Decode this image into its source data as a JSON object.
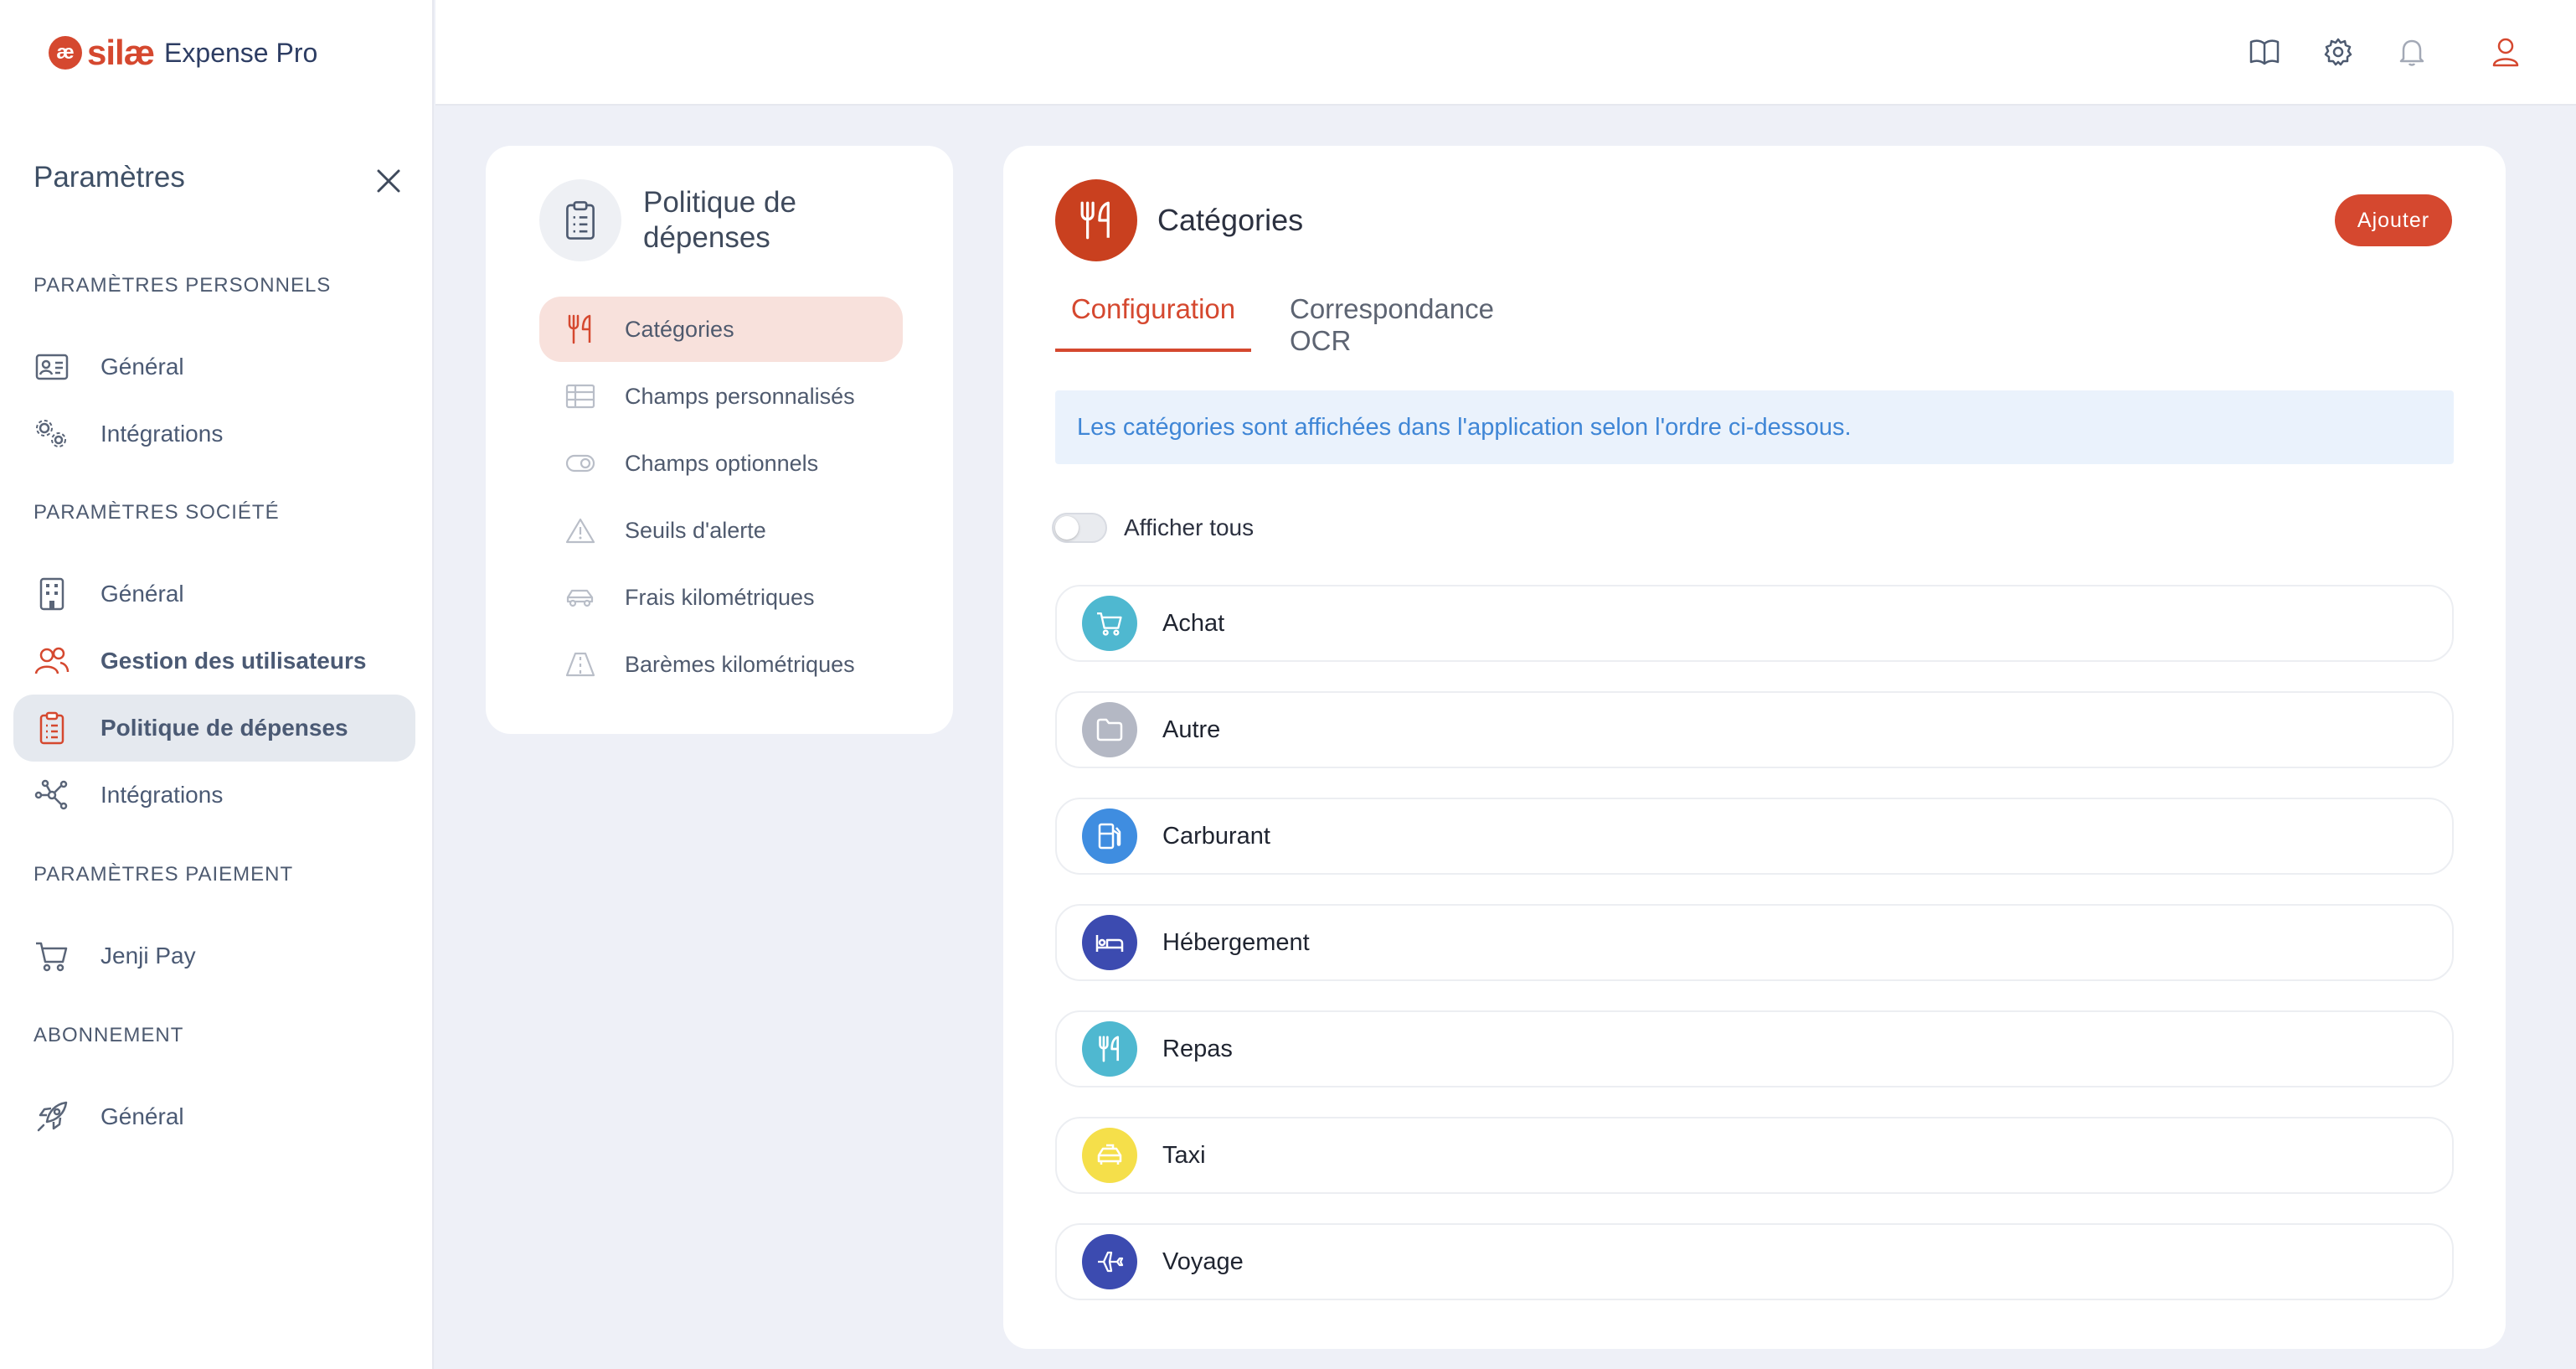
{
  "app": {
    "logo_mark": "æ",
    "brand": "silæ",
    "product": "Expense Pro"
  },
  "sidebar": {
    "title": "Paramètres",
    "sections": [
      {
        "label": "PARAMÈTRES PERSONNELS"
      },
      {
        "label": "PARAMÈTRES SOCIÉTÉ"
      },
      {
        "label": "PARAMÈTRES PAIEMENT"
      },
      {
        "label": "ABONNEMENT"
      }
    ],
    "items": [
      {
        "label": "Général",
        "icon": "id-card-icon"
      },
      {
        "label": "Intégrations",
        "icon": "gears-icon"
      },
      {
        "label": "Général",
        "icon": "building-icon"
      },
      {
        "label": "Gestion des utilisateurs",
        "icon": "users-icon"
      },
      {
        "label": "Politique de dépenses",
        "icon": "clipboard-icon",
        "active": true
      },
      {
        "label": "Intégrations",
        "icon": "network-icon"
      },
      {
        "label": "Jenji Pay",
        "icon": "cart-icon"
      },
      {
        "label": "Général",
        "icon": "rocket-icon"
      }
    ]
  },
  "topbar": {
    "icons": [
      "book-icon",
      "gear-icon",
      "bell-icon",
      "user-icon"
    ]
  },
  "policy": {
    "title": "Politique de dépenses",
    "items": [
      {
        "label": "Catégories",
        "icon": "fork-knife-icon",
        "active": true
      },
      {
        "label": "Champs personnalisés",
        "icon": "table-icon"
      },
      {
        "label": "Champs optionnels",
        "icon": "toggle-icon"
      },
      {
        "label": "Seuils d'alerte",
        "icon": "warning-icon"
      },
      {
        "label": "Frais kilométriques",
        "icon": "car-icon"
      },
      {
        "label": "Barèmes kilométriques",
        "icon": "road-icon"
      }
    ]
  },
  "main": {
    "title": "Catégories",
    "add_label": "Ajouter",
    "tabs": [
      {
        "label": "Configuration",
        "active": true
      },
      {
        "label": "Correspondance OCR",
        "active": false
      }
    ],
    "info": "Les catégories sont affichées dans l'application selon l'ordre ci-dessous.",
    "toggle_label": "Afficher tous",
    "toggle_on": false,
    "categories": [
      {
        "label": "Achat",
        "icon": "cart-icon",
        "color": "#4fb8d0"
      },
      {
        "label": "Autre",
        "icon": "folder-icon",
        "color": "#b4b8c4"
      },
      {
        "label": "Carburant",
        "icon": "fuel-icon",
        "color": "#3f8de0"
      },
      {
        "label": "Hébergement",
        "icon": "bed-icon",
        "color": "#3c4bb0"
      },
      {
        "label": "Repas",
        "icon": "fork-knife-icon",
        "color": "#4fb8d0"
      },
      {
        "label": "Taxi",
        "icon": "taxi-icon",
        "color": "#f5df4a"
      },
      {
        "label": "Voyage",
        "icon": "plane-icon",
        "color": "#3c4bb0"
      }
    ]
  },
  "colors": {
    "accent": "#d5482f",
    "info_text": "#3f86d6",
    "info_bg": "#eaf2fc"
  }
}
